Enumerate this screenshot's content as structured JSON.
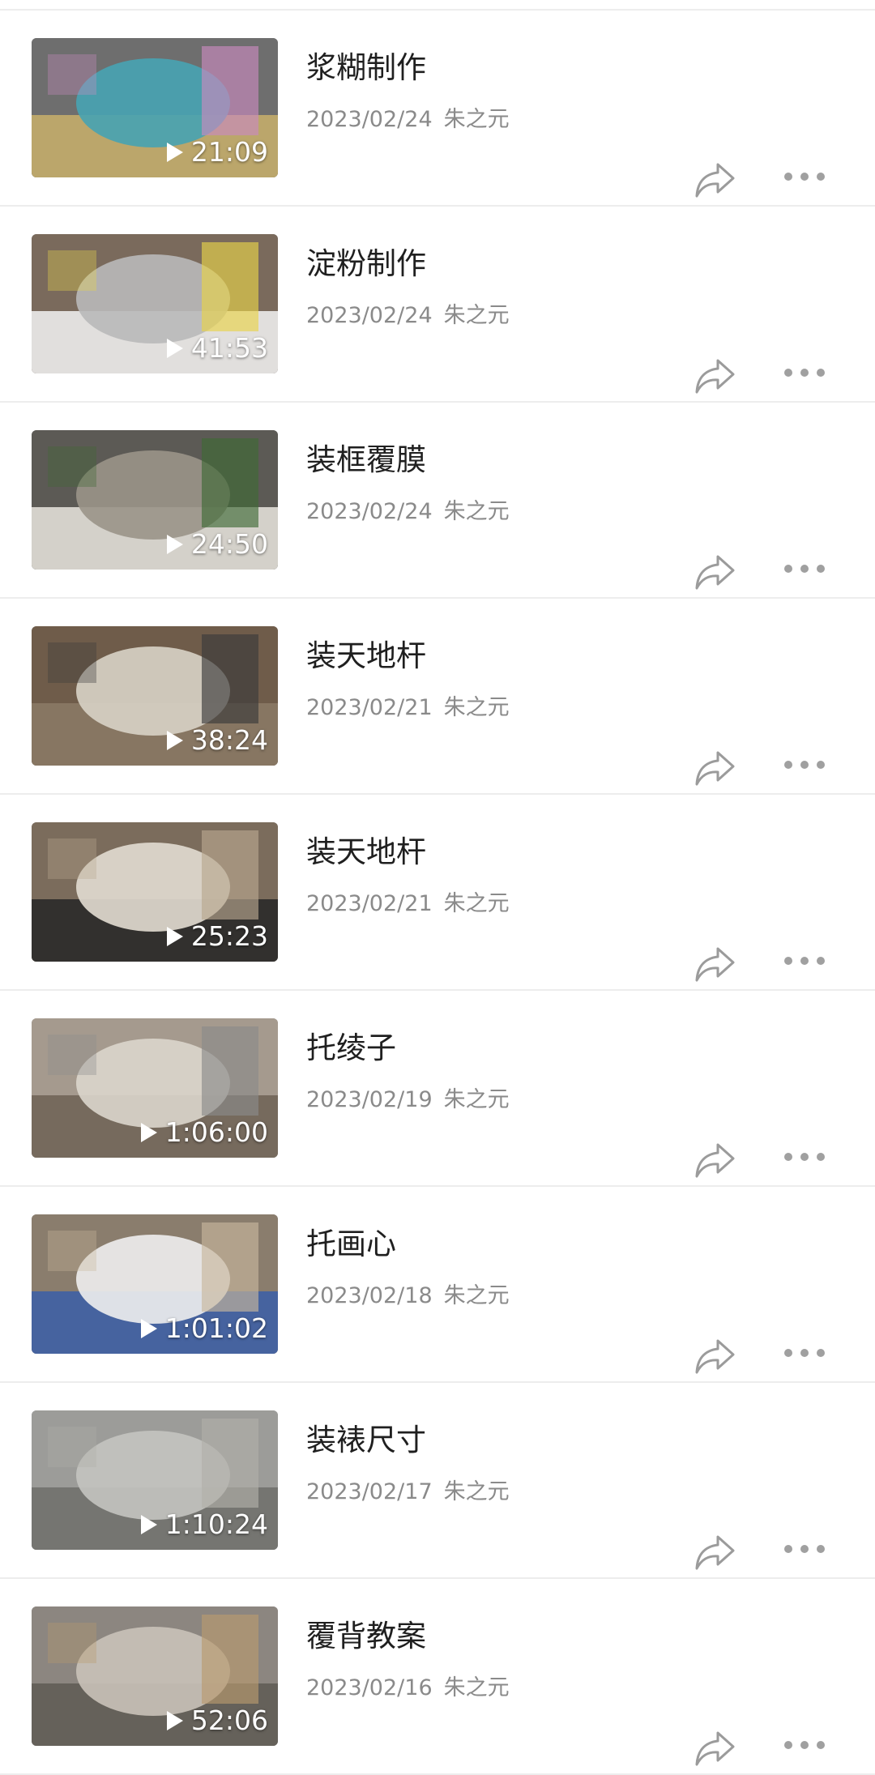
{
  "videos": [
    {
      "title": "浆糊制作",
      "date": "2023/02/24",
      "author": "朱之元",
      "duration": "21:09",
      "thumb_colors": [
        "#6e6e6e",
        "#47a3b3",
        "#c9b06b",
        "#c98bbf"
      ]
    },
    {
      "title": "淀粉制作",
      "date": "2023/02/24",
      "author": "朱之元",
      "duration": "41:53",
      "thumb_colors": [
        "#7a6a5c",
        "#b9b9b9",
        "#f3f3f3",
        "#e8d34a"
      ]
    },
    {
      "title": "装框覆膜",
      "date": "2023/02/24",
      "author": "朱之元",
      "duration": "24:50",
      "thumb_colors": [
        "#5c5a55",
        "#9a9488",
        "#e9e6df",
        "#3f6a35"
      ]
    },
    {
      "title": "装天地杆",
      "date": "2023/02/21",
      "author": "朱之元",
      "duration": "38:24",
      "thumb_colors": [
        "#6f5c4a",
        "#d8d3c7",
        "#8c7a66",
        "#3a3a3a"
      ]
    },
    {
      "title": "装天地杆",
      "date": "2023/02/21",
      "author": "朱之元",
      "duration": "25:23",
      "thumb_colors": [
        "#7b6c5c",
        "#e2ddd2",
        "#262626",
        "#b9a88f"
      ]
    },
    {
      "title": "托绫子",
      "date": "2023/02/19",
      "author": "朱之元",
      "duration": "1:06:00",
      "thumb_colors": [
        "#a59a8e",
        "#dcd6cc",
        "#6d6255",
        "#8b8b8b"
      ]
    },
    {
      "title": "托画心",
      "date": "2023/02/18",
      "author": "朱之元",
      "duration": "1:01:02",
      "thumb_colors": [
        "#8a7d6d",
        "#eeeeee",
        "#3a5ea8",
        "#c8b79c"
      ]
    },
    {
      "title": "装裱尺寸",
      "date": "2023/02/17",
      "author": "朱之元",
      "duration": "1:10:24",
      "thumb_colors": [
        "#9c9c99",
        "#c4c4c0",
        "#6f6f6a",
        "#b0afa9"
      ]
    },
    {
      "title": "覆背教案",
      "date": "2023/02/16",
      "author": "朱之元",
      "duration": "52:06",
      "thumb_colors": [
        "#8c8680",
        "#c9c2b8",
        "#5e5a54",
        "#b89a6e"
      ]
    }
  ]
}
